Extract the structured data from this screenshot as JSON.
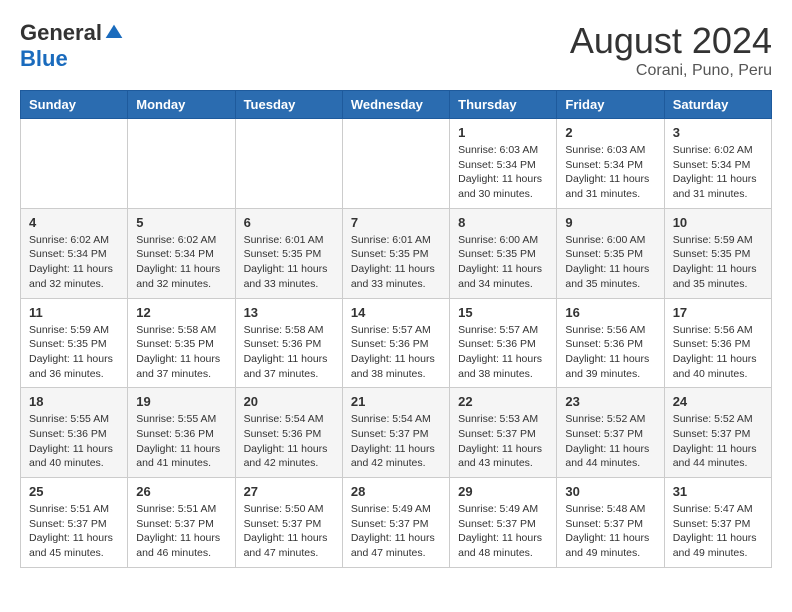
{
  "header": {
    "logo_general": "General",
    "logo_blue": "Blue",
    "month_year": "August 2024",
    "location": "Corani, Puno, Peru"
  },
  "days_of_week": [
    "Sunday",
    "Monday",
    "Tuesday",
    "Wednesday",
    "Thursday",
    "Friday",
    "Saturday"
  ],
  "weeks": [
    [
      {
        "day": "",
        "info": ""
      },
      {
        "day": "",
        "info": ""
      },
      {
        "day": "",
        "info": ""
      },
      {
        "day": "",
        "info": ""
      },
      {
        "day": "1",
        "info": "Sunrise: 6:03 AM\nSunset: 5:34 PM\nDaylight: 11 hours\nand 30 minutes."
      },
      {
        "day": "2",
        "info": "Sunrise: 6:03 AM\nSunset: 5:34 PM\nDaylight: 11 hours\nand 31 minutes."
      },
      {
        "day": "3",
        "info": "Sunrise: 6:02 AM\nSunset: 5:34 PM\nDaylight: 11 hours\nand 31 minutes."
      }
    ],
    [
      {
        "day": "4",
        "info": "Sunrise: 6:02 AM\nSunset: 5:34 PM\nDaylight: 11 hours\nand 32 minutes."
      },
      {
        "day": "5",
        "info": "Sunrise: 6:02 AM\nSunset: 5:34 PM\nDaylight: 11 hours\nand 32 minutes."
      },
      {
        "day": "6",
        "info": "Sunrise: 6:01 AM\nSunset: 5:35 PM\nDaylight: 11 hours\nand 33 minutes."
      },
      {
        "day": "7",
        "info": "Sunrise: 6:01 AM\nSunset: 5:35 PM\nDaylight: 11 hours\nand 33 minutes."
      },
      {
        "day": "8",
        "info": "Sunrise: 6:00 AM\nSunset: 5:35 PM\nDaylight: 11 hours\nand 34 minutes."
      },
      {
        "day": "9",
        "info": "Sunrise: 6:00 AM\nSunset: 5:35 PM\nDaylight: 11 hours\nand 35 minutes."
      },
      {
        "day": "10",
        "info": "Sunrise: 5:59 AM\nSunset: 5:35 PM\nDaylight: 11 hours\nand 35 minutes."
      }
    ],
    [
      {
        "day": "11",
        "info": "Sunrise: 5:59 AM\nSunset: 5:35 PM\nDaylight: 11 hours\nand 36 minutes."
      },
      {
        "day": "12",
        "info": "Sunrise: 5:58 AM\nSunset: 5:35 PM\nDaylight: 11 hours\nand 37 minutes."
      },
      {
        "day": "13",
        "info": "Sunrise: 5:58 AM\nSunset: 5:36 PM\nDaylight: 11 hours\nand 37 minutes."
      },
      {
        "day": "14",
        "info": "Sunrise: 5:57 AM\nSunset: 5:36 PM\nDaylight: 11 hours\nand 38 minutes."
      },
      {
        "day": "15",
        "info": "Sunrise: 5:57 AM\nSunset: 5:36 PM\nDaylight: 11 hours\nand 38 minutes."
      },
      {
        "day": "16",
        "info": "Sunrise: 5:56 AM\nSunset: 5:36 PM\nDaylight: 11 hours\nand 39 minutes."
      },
      {
        "day": "17",
        "info": "Sunrise: 5:56 AM\nSunset: 5:36 PM\nDaylight: 11 hours\nand 40 minutes."
      }
    ],
    [
      {
        "day": "18",
        "info": "Sunrise: 5:55 AM\nSunset: 5:36 PM\nDaylight: 11 hours\nand 40 minutes."
      },
      {
        "day": "19",
        "info": "Sunrise: 5:55 AM\nSunset: 5:36 PM\nDaylight: 11 hours\nand 41 minutes."
      },
      {
        "day": "20",
        "info": "Sunrise: 5:54 AM\nSunset: 5:36 PM\nDaylight: 11 hours\nand 42 minutes."
      },
      {
        "day": "21",
        "info": "Sunrise: 5:54 AM\nSunset: 5:37 PM\nDaylight: 11 hours\nand 42 minutes."
      },
      {
        "day": "22",
        "info": "Sunrise: 5:53 AM\nSunset: 5:37 PM\nDaylight: 11 hours\nand 43 minutes."
      },
      {
        "day": "23",
        "info": "Sunrise: 5:52 AM\nSunset: 5:37 PM\nDaylight: 11 hours\nand 44 minutes."
      },
      {
        "day": "24",
        "info": "Sunrise: 5:52 AM\nSunset: 5:37 PM\nDaylight: 11 hours\nand 44 minutes."
      }
    ],
    [
      {
        "day": "25",
        "info": "Sunrise: 5:51 AM\nSunset: 5:37 PM\nDaylight: 11 hours\nand 45 minutes."
      },
      {
        "day": "26",
        "info": "Sunrise: 5:51 AM\nSunset: 5:37 PM\nDaylight: 11 hours\nand 46 minutes."
      },
      {
        "day": "27",
        "info": "Sunrise: 5:50 AM\nSunset: 5:37 PM\nDaylight: 11 hours\nand 47 minutes."
      },
      {
        "day": "28",
        "info": "Sunrise: 5:49 AM\nSunset: 5:37 PM\nDaylight: 11 hours\nand 47 minutes."
      },
      {
        "day": "29",
        "info": "Sunrise: 5:49 AM\nSunset: 5:37 PM\nDaylight: 11 hours\nand 48 minutes."
      },
      {
        "day": "30",
        "info": "Sunrise: 5:48 AM\nSunset: 5:37 PM\nDaylight: 11 hours\nand 49 minutes."
      },
      {
        "day": "31",
        "info": "Sunrise: 5:47 AM\nSunset: 5:37 PM\nDaylight: 11 hours\nand 49 minutes."
      }
    ]
  ]
}
